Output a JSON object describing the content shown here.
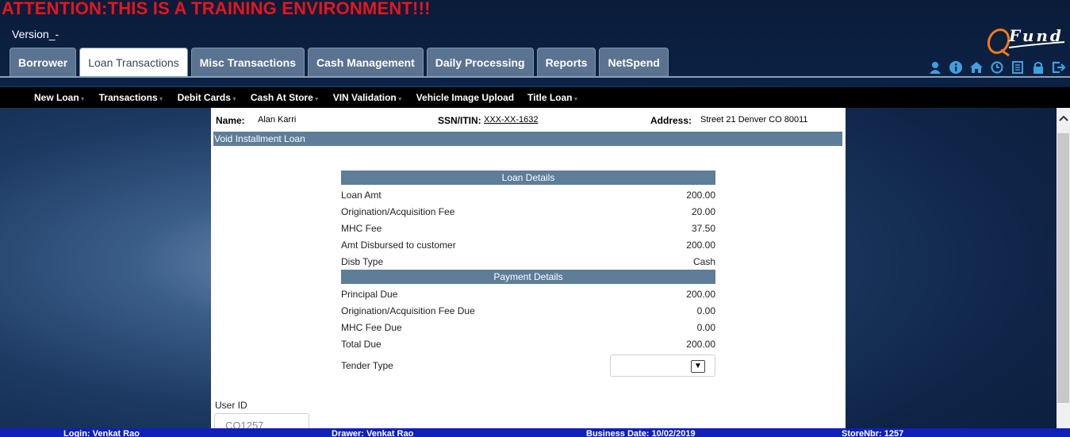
{
  "banner": "ATTENTION:THIS IS A TRAINING ENVIRONMENT!!!",
  "version": "Version_-",
  "logo_text": "Fund",
  "tabs": [
    {
      "label": "Borrower",
      "active": false
    },
    {
      "label": "Loan Transactions",
      "active": true
    },
    {
      "label": "Misc Transactions",
      "active": false
    },
    {
      "label": "Cash Management",
      "active": false
    },
    {
      "label": "Daily Processing",
      "active": false
    },
    {
      "label": "Reports",
      "active": false
    },
    {
      "label": "NetSpend",
      "active": false
    }
  ],
  "header_icons": [
    "user-icon",
    "info-icon",
    "home-icon",
    "clock-icon",
    "notes-icon",
    "lock-icon",
    "logout-icon"
  ],
  "submenu": [
    "New Loan",
    "Transactions",
    "Debit Cards",
    "Cash At Store",
    "VIN Validation",
    "Vehicle Image Upload",
    "Title Loan"
  ],
  "customer": {
    "name_label": "Name:",
    "name": "Alan  Karri",
    "ssn_label": "SSN/ITIN:",
    "ssn": "XXX-XX-1632",
    "address_label": "Address:",
    "address": "Street 21  Denver  CO  80011"
  },
  "page_title": "Void Installment Loan",
  "loan_details": {
    "heading": "Loan Details",
    "rows": [
      {
        "label": "Loan Amt",
        "value": "200.00"
      },
      {
        "label": "Origination/Acquisition Fee",
        "value": "20.00"
      },
      {
        "label": "MHC Fee",
        "value": "37.50"
      },
      {
        "label": "Amt Disbursed to customer",
        "value": "200.00"
      },
      {
        "label": "Disb Type",
        "value": "Cash"
      }
    ]
  },
  "payment_details": {
    "heading": "Payment Details",
    "rows": [
      {
        "label": "Principal Due",
        "value": "200.00"
      },
      {
        "label": "Origination/Acquisition Fee Due",
        "value": "0.00"
      },
      {
        "label": "MHC Fee Due",
        "value": "0.00"
      },
      {
        "label": "Total Due",
        "value": "200.00"
      }
    ]
  },
  "tender_type": {
    "label": "Tender Type",
    "value": ""
  },
  "user_id": {
    "label": "User ID",
    "value": "CO1257"
  },
  "status_bar": {
    "login": "Login: Venkat Rao",
    "drawer": "Drawer: Venkat Rao",
    "business_date": "Business Date: 10/02/2019",
    "store": "StoreNbr: 1257"
  },
  "colors": {
    "banner": "#e8141c",
    "tab": "#5a7390",
    "section_header": "#5e7d99",
    "status_bar": "#1020b8",
    "icons": "#3fa0e0"
  }
}
